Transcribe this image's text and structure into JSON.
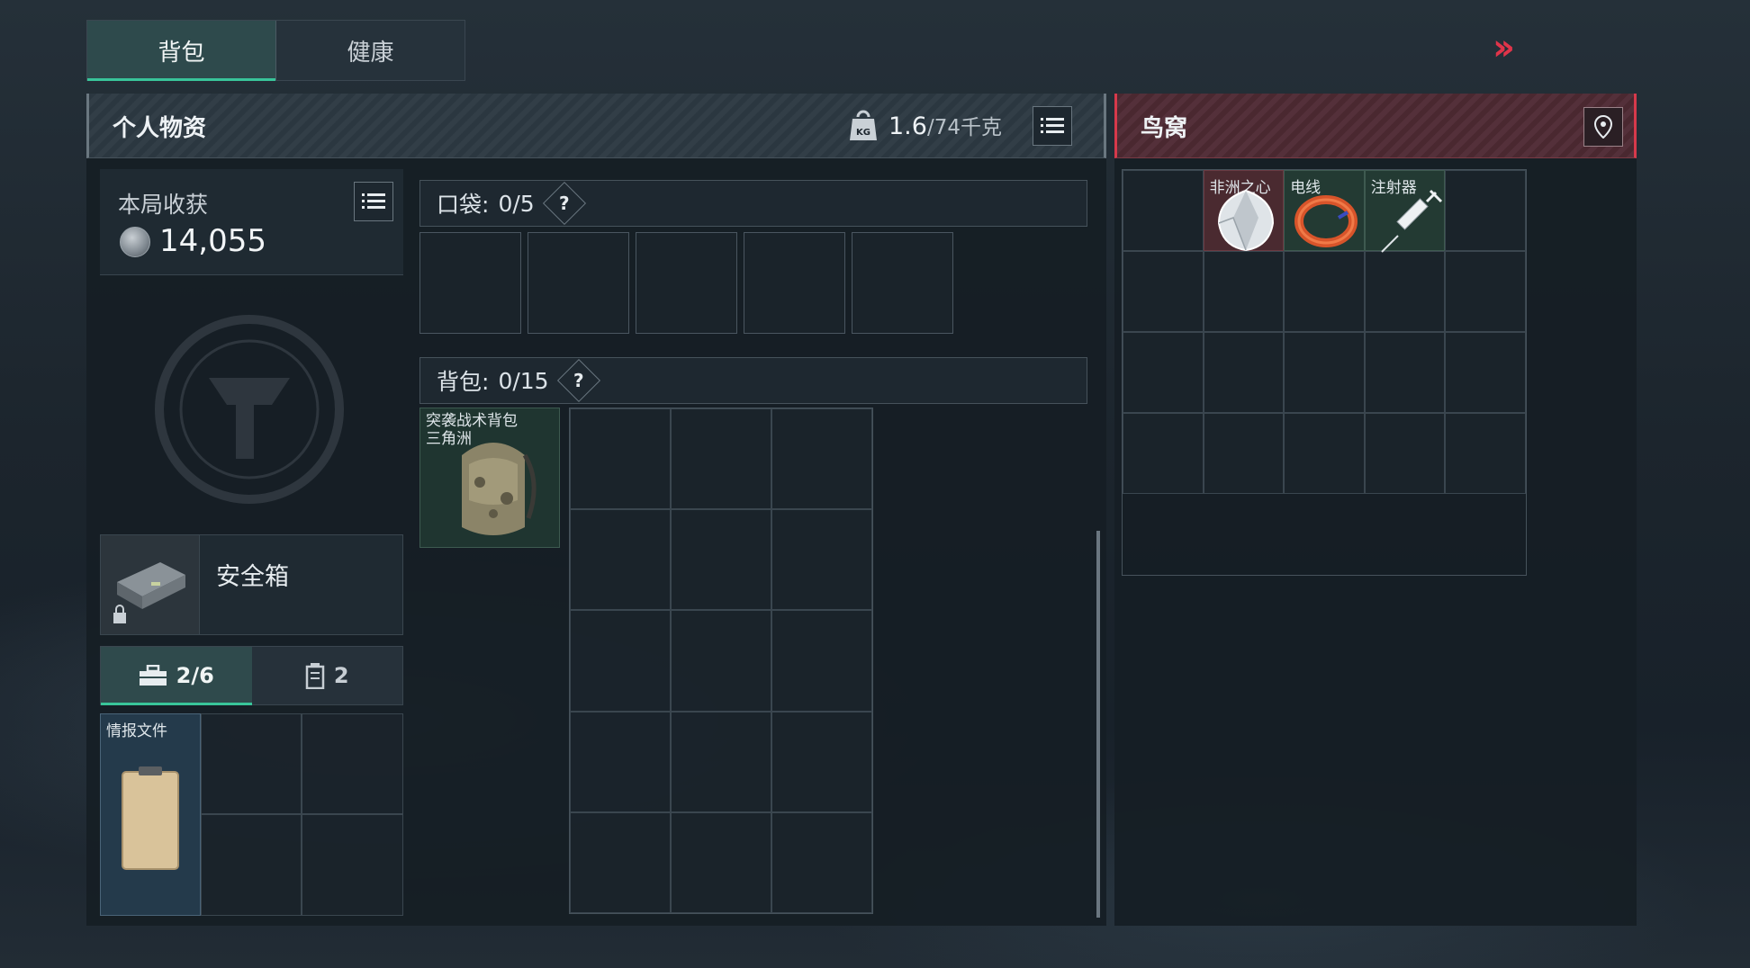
{
  "tabs": [
    {
      "label": "背包",
      "active": true
    },
    {
      "label": "健康",
      "active": false
    }
  ],
  "personal": {
    "title": "个人物资",
    "weight_current": "1.6",
    "weight_capacity": "/74千克",
    "weight_icon_text": "KG"
  },
  "income": {
    "label": "本局收获",
    "value": "14,055"
  },
  "safe_box": {
    "label": "安全箱"
  },
  "subtabs": [
    {
      "label": "2/6",
      "icon": "toolbox-icon",
      "active": true
    },
    {
      "label": "2",
      "icon": "canister-icon",
      "active": false
    }
  ],
  "pouch": {
    "items": [
      {
        "name": "情报文件"
      }
    ]
  },
  "pockets": {
    "label": "口袋:",
    "count": "0/5",
    "help": "?"
  },
  "backpack": {
    "label": "背包:",
    "count": "0/15",
    "help": "?",
    "equipped": {
      "name": "突袭战术背包",
      "variant": "三角洲"
    }
  },
  "loot": {
    "title": "鸟窝",
    "items": [
      {
        "name": "非洲之心",
        "rarity_color": "#4a2a30"
      },
      {
        "name": "电线",
        "rarity_color": "#233a33"
      },
      {
        "name": "注射器",
        "rarity_color": "#233a33"
      }
    ]
  },
  "colors": {
    "accent_green": "#39c59a",
    "accent_red": "#d7394b"
  }
}
